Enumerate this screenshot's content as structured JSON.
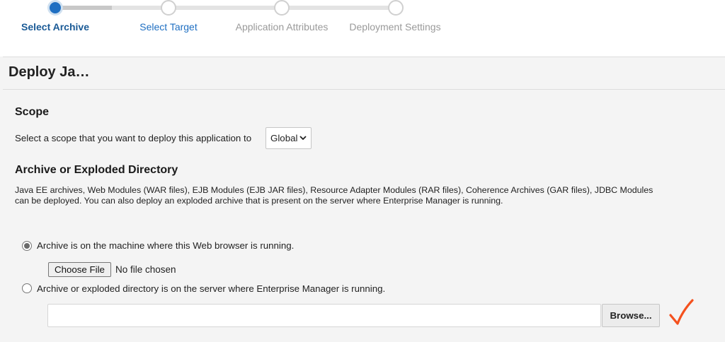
{
  "train": {
    "steps": [
      {
        "label": "Select Archive",
        "state": "current"
      },
      {
        "label": "Select Target",
        "state": "visited"
      },
      {
        "label": "Application Attributes",
        "state": "future"
      },
      {
        "label": "Deployment Settings",
        "state": "future"
      }
    ]
  },
  "header": {
    "title": "Deploy Ja…"
  },
  "scope": {
    "title": "Scope",
    "prompt": "Select a scope that you want to deploy this application to",
    "selected": "Global"
  },
  "archive": {
    "title": "Archive or Exploded Directory",
    "description_line1": "Java EE archives, Web Modules (WAR files), EJB Modules (EJB JAR files), Resource Adapter Modules (RAR files), Coherence Archives (GAR files), JDBC Modules",
    "description_line2": "can be deployed. You can also deploy an exploded archive that is present on the server where Enterprise Manager is running.",
    "option_local": "Archive is on the machine where this Web browser is running.",
    "choose_file_label": "Choose File",
    "no_file_text": "No file chosen",
    "option_server": "Archive or exploded directory is on the server where Enterprise Manager is running.",
    "path_value": "",
    "browse_label": "Browse..."
  },
  "colors": {
    "accent": "#1f6fc2",
    "check_mark": "#f4511e"
  },
  "icons": {
    "select_chevron": "chevron-down-icon",
    "annotation": "check-mark-icon"
  }
}
